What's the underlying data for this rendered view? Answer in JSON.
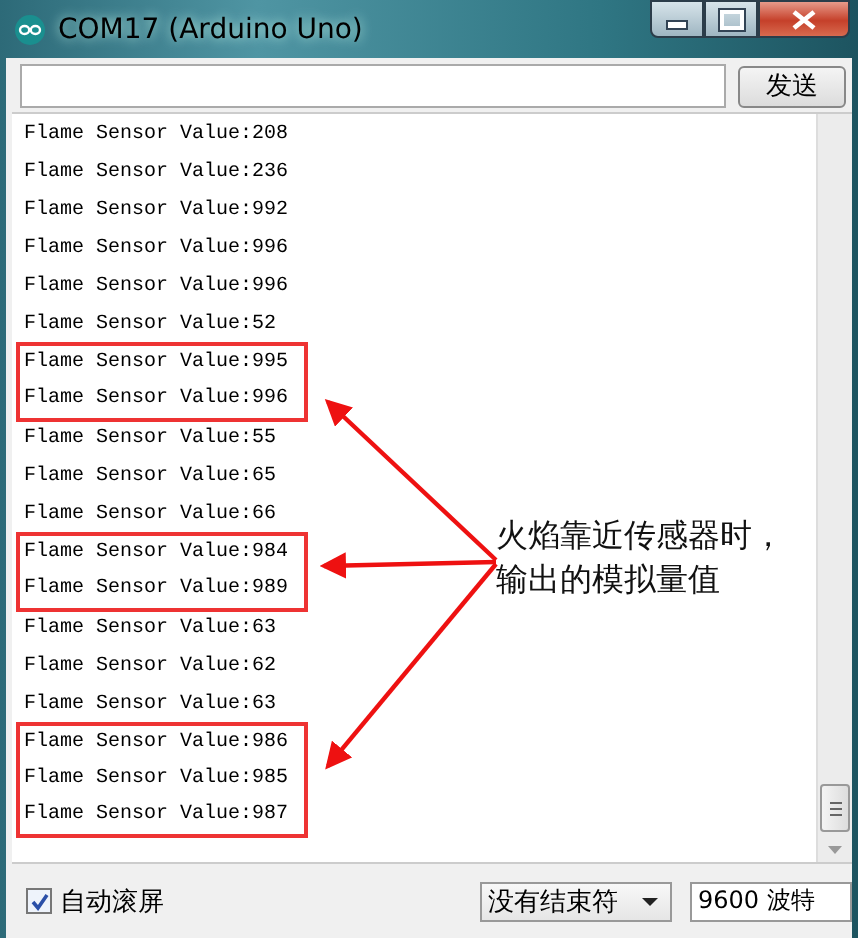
{
  "window": {
    "title": "COM17 (Arduino Uno)"
  },
  "send_button": {
    "label": "发送"
  },
  "output": [
    {
      "kind": "plain",
      "lines": [
        "Flame Sensor Value:208",
        "Flame Sensor Value:236",
        "Flame Sensor Value:992",
        "Flame Sensor Value:996",
        "Flame Sensor Value:996",
        "Flame Sensor Value:52"
      ]
    },
    {
      "kind": "highlight",
      "lines": [
        "Flame Sensor Value:995",
        "Flame Sensor Value:996"
      ]
    },
    {
      "kind": "plain",
      "lines": [
        "Flame Sensor Value:55",
        "Flame Sensor Value:65",
        "Flame Sensor Value:66"
      ]
    },
    {
      "kind": "highlight",
      "lines": [
        "Flame Sensor Value:984",
        "Flame Sensor Value:989"
      ]
    },
    {
      "kind": "plain",
      "lines": [
        "Flame Sensor Value:63",
        "Flame Sensor Value:62",
        "Flame Sensor Value:63"
      ]
    },
    {
      "kind": "highlight",
      "lines": [
        "Flame Sensor Value:986",
        "Flame Sensor Value:985",
        "Flame Sensor Value:987"
      ]
    }
  ],
  "annotation": {
    "text": "火焰靠近传感器时，输出的模拟量值"
  },
  "autoscroll": {
    "label": "自动滚屏",
    "checked": true
  },
  "line_ending": {
    "value": "没有结束符"
  },
  "baud_rate": {
    "value": "9600 波特"
  }
}
